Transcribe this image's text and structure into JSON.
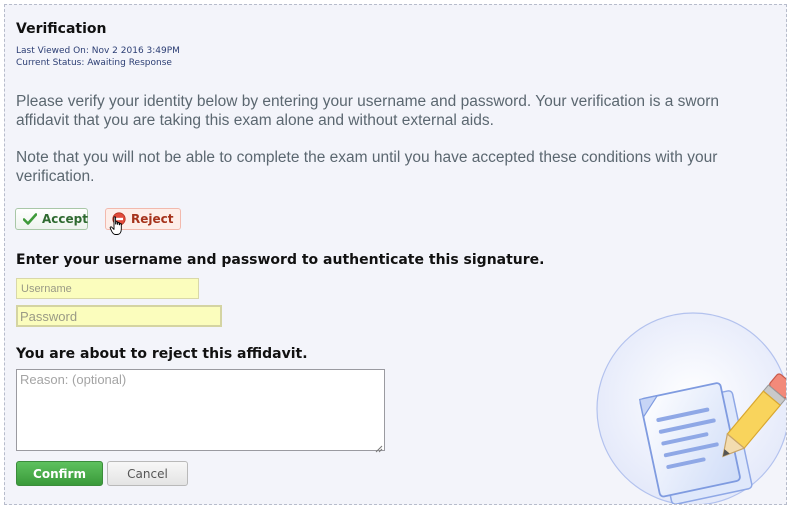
{
  "header": {
    "title": "Verification",
    "last_viewed": "Last Viewed On: Nov 2 2016 3:49PM",
    "status": "Current Status: Awaiting Response"
  },
  "body": {
    "paragraph1": "Please verify your identity below by entering your username and password. Your verification is a sworn affidavit that you are taking this exam alone and without external aids.",
    "paragraph2": "Note that you will not be able to complete the exam until you have accepted these conditions with your verification."
  },
  "actions": {
    "accept_label": "Accept",
    "reject_label": "Reject"
  },
  "auth": {
    "heading": "Enter your username and password to authenticate this signature.",
    "username_placeholder": "Username",
    "password_placeholder": "Password"
  },
  "reject_section": {
    "heading": "You are about to reject this affidavit.",
    "reason_placeholder": "Reason: (optional)"
  },
  "footer": {
    "confirm_label": "Confirm",
    "cancel_label": "Cancel"
  },
  "colors": {
    "panel_background": "#f3f4fa",
    "accept_green": "#2f6a30",
    "reject_red": "#a5321b",
    "confirm_green": "#3a9a3a",
    "input_yellow": "#fbfdbd"
  },
  "icons": {
    "accept": "checkmark-icon",
    "reject": "no-entry-icon",
    "cursor": "hand-pointer-icon",
    "illustration": "document-pencil-icon"
  }
}
